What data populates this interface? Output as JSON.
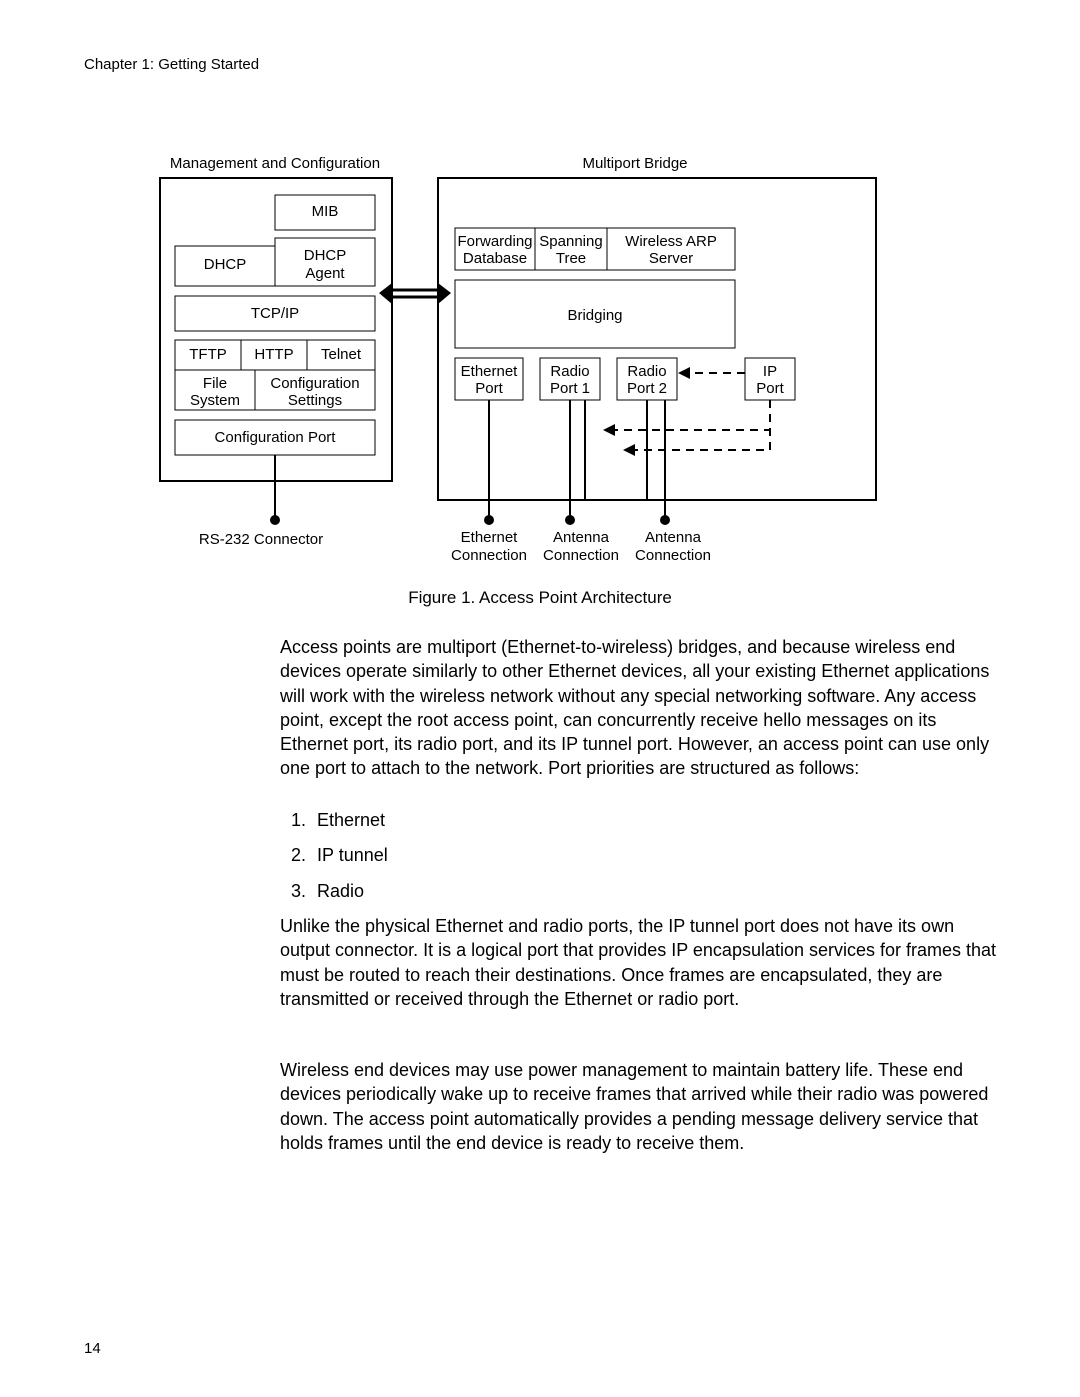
{
  "header": {
    "chapter": "Chapter 1: Getting Started"
  },
  "footer": {
    "page_number": "14"
  },
  "diagram": {
    "titles": {
      "left": "Management and Configuration",
      "right": "Multiport Bridge"
    },
    "left_panel": {
      "mib": "MIB",
      "dhcp": "DHCP",
      "dhcp_agent_1": "DHCP",
      "dhcp_agent_2": "Agent",
      "tcpip": "TCP/IP",
      "tftp": "TFTP",
      "http": "HTTP",
      "telnet": "Telnet",
      "file_sys_1": "File",
      "file_sys_2": "System",
      "cfg_set_1": "Configuration",
      "cfg_set_2": "Settings",
      "cfg_port": "Configuration Port"
    },
    "right_panel": {
      "fwd_db_1": "Forwarding",
      "fwd_db_2": "Database",
      "spt_1": "Spanning",
      "spt_2": "Tree",
      "wireless_arp_1": "Wireless ARP",
      "wireless_arp_2": "Server",
      "bridging": "Bridging",
      "eth_port_1": "Ethernet",
      "eth_port_2": "Port",
      "radio1_1": "Radio",
      "radio1_2": "Port 1",
      "radio2_1": "Radio",
      "radio2_2": "Port 2",
      "ip_port_1": "IP",
      "ip_port_2": "Port"
    },
    "bottom_labels": {
      "rs232": "RS-232 Connector",
      "eth_conn_1": "Ethernet",
      "eth_conn_2": "Connection",
      "ant1_1": "Antenna",
      "ant1_2": "Connection",
      "ant2_1": "Antenna",
      "ant2_2": "Connection"
    }
  },
  "caption": "Figure 1. Access Point Architecture",
  "body": {
    "p1": "Access points are multiport (Ethernet-to-wireless) bridges, and because wireless end devices operate similarly to other Ethernet devices, all your existing Ethernet applications will work with the wireless network without any special networking software. Any access point, except the root access point, can concurrently receive hello messages on its Ethernet port, its radio port, and its IP tunnel port. However, an access point can use only one port to attach to the network. Port priorities are structured as follows:",
    "list": {
      "i1": {
        "num": "1.",
        "txt": "Ethernet"
      },
      "i2": {
        "num": "2.",
        "txt": "IP tunnel"
      },
      "i3": {
        "num": "3.",
        "txt": "Radio"
      }
    },
    "p2": "Unlike the physical Ethernet and radio ports, the IP tunnel port does not have its own output connector. It is a logical port that provides IP encapsulation services for frames that must be routed to reach their destinations. Once frames are encapsulated, they are transmitted or received through the Ethernet or radio port.",
    "p3": "Wireless end devices may use power management to maintain battery life. These end devices periodically wake up to receive frames that arrived while their radio was powered down. The access point automatically provides a pending message delivery service that holds frames until the end device is ready to receive them."
  }
}
